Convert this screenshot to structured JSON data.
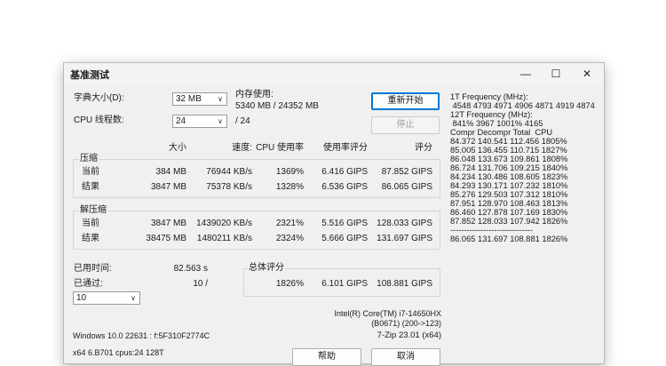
{
  "window": {
    "title": "基准测试",
    "controls": {
      "minimize": "—",
      "maximize": "☐",
      "close": "✕"
    }
  },
  "settings": {
    "dict_label": "字典大小(D):",
    "dict_value": "32 MB",
    "threads_label": "CPU 线程数:",
    "threads_value": "24",
    "memory_label": "内存使用:",
    "memory_value": "5340 MB / 24352 MB",
    "threads_total": "/ 24"
  },
  "buttons": {
    "restart": "重新开始",
    "stop": "停止",
    "help": "帮助",
    "cancel": "取消"
  },
  "table": {
    "headers": {
      "size": "大小",
      "speed": "速度:",
      "cpu": "CPU 使用率",
      "rating": "使用率评分",
      "score": "评分"
    },
    "compress": {
      "label": "压缩",
      "rows": [
        {
          "label": "当前",
          "size": "384 MB",
          "speed": "76944 KB/s",
          "cpu": "1369%",
          "rating": "6.416 GIPS",
          "score": "87.852 GIPS"
        },
        {
          "label": "结果",
          "size": "3847 MB",
          "speed": "75378 KB/s",
          "cpu": "1328%",
          "rating": "6.536 GIPS",
          "score": "86.065 GIPS"
        }
      ]
    },
    "decompress": {
      "label": "解压缩",
      "rows": [
        {
          "label": "当前",
          "size": "3847 MB",
          "speed": "1439020 KB/s",
          "cpu": "2321%",
          "rating": "5.516 GIPS",
          "score": "128.033 GIPS"
        },
        {
          "label": "结果",
          "size": "38475 MB",
          "speed": "1480211 KB/s",
          "cpu": "2324%",
          "rating": "5.666 GIPS",
          "score": "131.697 GIPS"
        }
      ]
    }
  },
  "elapsed": {
    "label": "已用时间:",
    "value": "82.563 s"
  },
  "passes": {
    "label": "已通过:",
    "value": "10 /",
    "select_value": "10"
  },
  "total": {
    "label": "总体评分",
    "cpu": "1826%",
    "rating": "6.101 GIPS",
    "score": "108.881 GIPS"
  },
  "system": {
    "cpu_line1": "Intel(R) Core(TM) i7-14650HX",
    "cpu_line2": "(B0671) (200->123)",
    "os": "Windows 10.0 22631 : f:5F310F2774C",
    "version": "7-Zip 23.01 (x64)",
    "arch": "x64 6.B701 cpus:24 128T"
  },
  "freq_log": [
    "1T Frequency (MHz):",
    " 4548 4793 4971 4906 4871 4919 4874",
    "12T Frequency (MHz):",
    " 841% 3967 1001% 4165",
    "Compr Decompr Total  CPU",
    "84.372 140.541 112.456 1805%",
    "85.005 136.455 110.715 1827%",
    "86.048 133.673 109.861 1808%",
    "86.724 131.706 109.215 1840%",
    "84.234 130.486 108.605 1823%",
    "84.293 130.171 107.232 1810%",
    "85.276 129.503 107.312 1810%",
    "87.951 128.970 108.463 1813%",
    "86.460 127.878 107.169 1830%",
    "87.852 128.033 107.942 1826%",
    "------------------------------",
    "86.065 131.697 108.881 1826%"
  ]
}
